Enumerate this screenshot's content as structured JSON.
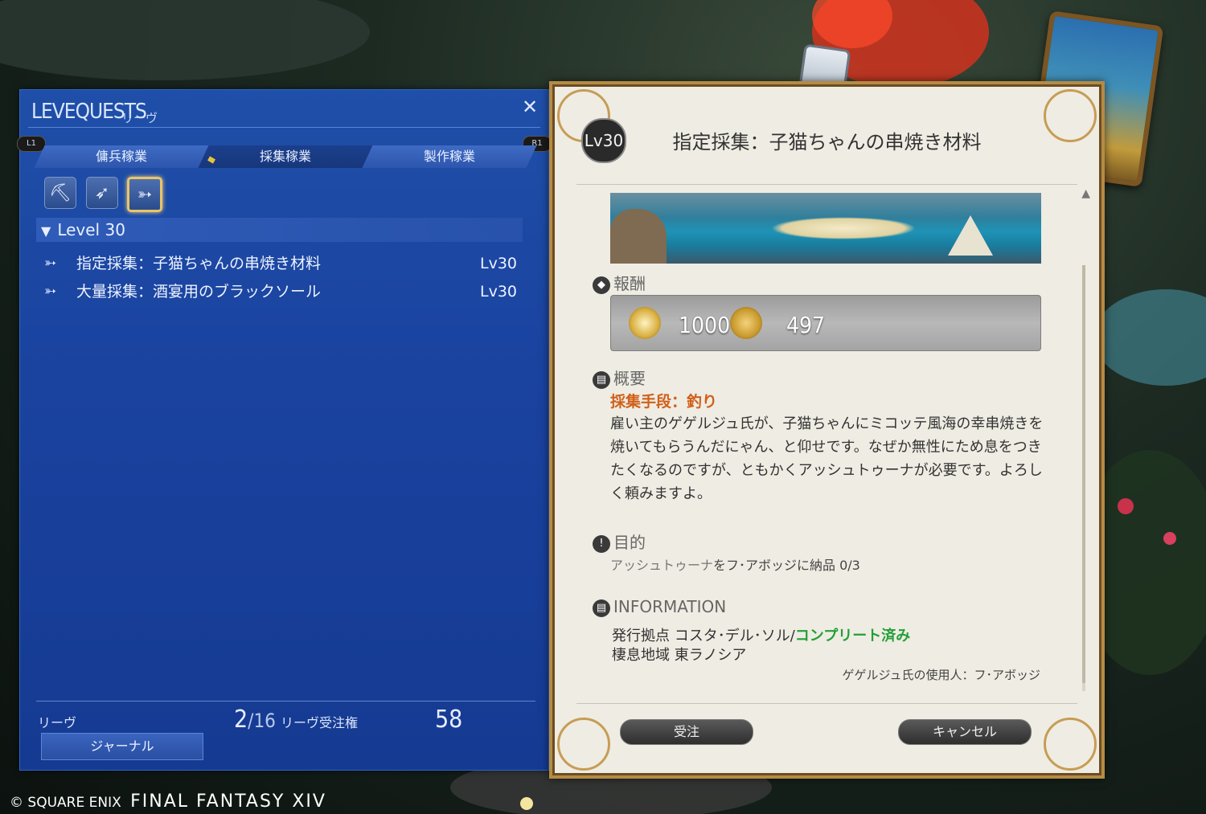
{
  "left_panel": {
    "title_en": "LEVEQUESTS",
    "title_jp": "リーヴ",
    "close_glyph": "✕",
    "shoulder_left": "L1",
    "shoulder_right": "R1",
    "tabs": [
      {
        "label": "傭兵稼業"
      },
      {
        "label": "採集稼業"
      },
      {
        "label": "製作稼業"
      }
    ],
    "class_icons": [
      "pickaxe-icon",
      "hatchet-icon",
      "fishing-icon"
    ],
    "level_header": "Level 30",
    "quests": [
      {
        "title": "指定採集：子猫ちゃんの串焼き材料",
        "level": "Lv30"
      },
      {
        "title": "大量採集：酒宴用のブラックソール",
        "level": "Lv30"
      }
    ],
    "footer": {
      "leve_label": "リーヴ",
      "leve_count_current": "2",
      "leve_count_total": "/16",
      "allowance_label": "リーヴ受注権",
      "allowance_value": "58",
      "journal_button": "ジャーナル"
    }
  },
  "detail": {
    "level_badge": "Lv30",
    "title": "指定採集：子猫ちゃんの串焼き材料",
    "reward_heading": "報酬",
    "rewards": {
      "exp": "1000",
      "gil": "497"
    },
    "summary_heading": "概要",
    "method": "採集手段：釣り",
    "summary": "雇い主のゲゲルジュ氏が、子猫ちゃんにミコッテ風海の幸串焼きを焼いてもらうんだにゃん、と仰せです。なぜか無性にため息をつきたくなるのですが、ともかくアッシュトゥーナが必要です。よろしく頼みますよ。",
    "objective_heading": "目的",
    "objective_item": "アッシュトゥーナ",
    "objective_text": "をフ･アボッジに納品 0/3",
    "info_heading": "INFORMATION",
    "issuing_label": "発行拠点 コスタ･デル･ソル/",
    "issuing_status": "コンプリート済み",
    "region": "棲息地域 東ラノシア",
    "issuer": "ゲゲルジュ氏の使用人：フ･アボッジ",
    "accept_button": "受注",
    "cancel_button": "キャンセル"
  },
  "copyright": {
    "company": "© SQUARE ENIX",
    "game": "FINAL FANTASY XIV"
  },
  "colors": {
    "panel_blue": "#1a43a0",
    "parchment": "#efece3",
    "gold_border": "#b58b45",
    "complete_green": "#22a038",
    "method_orange": "#d0601a"
  }
}
